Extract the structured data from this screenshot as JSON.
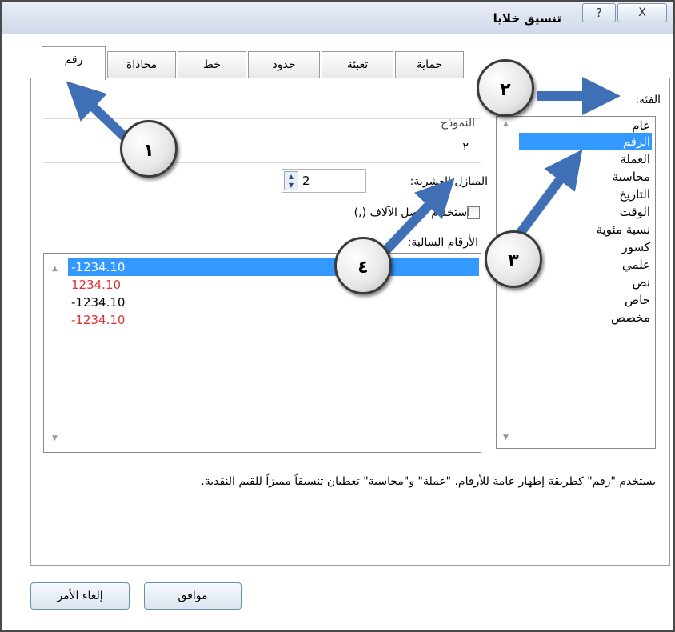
{
  "window": {
    "title": "تنسيق خلايا",
    "help_label": "?",
    "close_label": "X"
  },
  "tabs": [
    "رقم",
    "محاذاة",
    "خط",
    "حدود",
    "تعبئة",
    "حماية"
  ],
  "category": {
    "label": "الفئة:",
    "items": [
      "عام",
      "الرقم",
      "العملة",
      "محاسبة",
      "التاريخ",
      "الوقت",
      "نسبة مئوية",
      "كسور",
      "علمي",
      "نص",
      "خاص",
      "مخصص"
    ],
    "selected": "الرقم"
  },
  "sample": {
    "label": "النموذج",
    "value": "٢"
  },
  "decimal_places": {
    "label": "المنازل العشرية:",
    "value": "2"
  },
  "thousands_separator": {
    "label": "استخدام فاصل الآلاف (,)",
    "checked": false
  },
  "negative_numbers": {
    "label": "الأرقام السالبة:",
    "items": [
      {
        "text": "-1234.10",
        "color": "#000000"
      },
      {
        "text": "1234.10",
        "color": "#e03030"
      },
      {
        "text": "-1234.10",
        "color": "#000000"
      },
      {
        "text": "-1234.10",
        "color": "#e03030"
      }
    ]
  },
  "description": "يستخدم \"رقم\" كطريقة إظهار عامة للأرقام. \"عملة\" و\"محاسبة\" تعطيان تنسيقاً مميزاً للقيم النقدية.",
  "buttons": {
    "ok": "موافق",
    "cancel": "إلغاء الأمر"
  },
  "callouts": [
    "١",
    "٢",
    "٣",
    "٤"
  ],
  "colors": {
    "selection": "#3399ff",
    "arrow": "#3f6fb5",
    "negative_red": "#e03030"
  }
}
